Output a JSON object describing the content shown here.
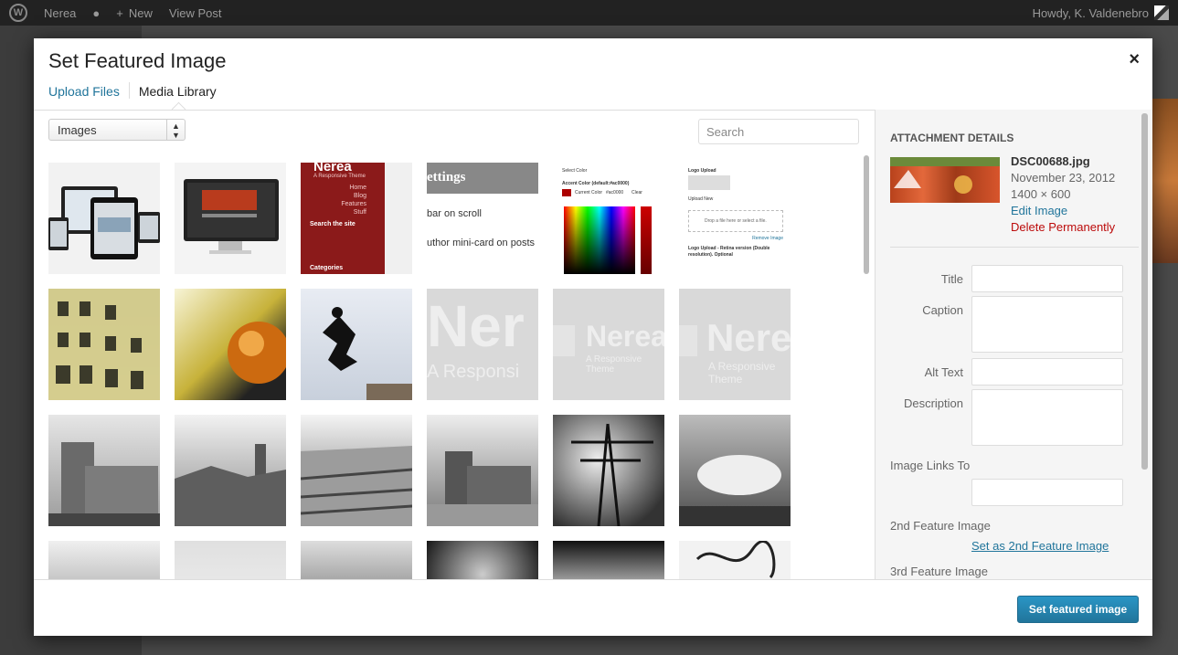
{
  "adminbar": {
    "site_name": "Nerea",
    "new_label": "New",
    "view_post": "View Post",
    "howdy": "Howdy, K. Valdenebro"
  },
  "modal": {
    "title": "Set Featured Image",
    "close": "×",
    "tabs": {
      "upload": "Upload Files",
      "library": "Media Library"
    }
  },
  "toolbar": {
    "filter_value": "Images",
    "search_placeholder": "Search"
  },
  "thumbs": {
    "t3_title": "Nerea",
    "t3_sub": "A Responsive Theme",
    "t3_menu": [
      "Home",
      "Blog",
      "Features",
      "Stuff"
    ],
    "t3_search": "Search the site",
    "t3_categories": "Categories",
    "t4_title": "ettings",
    "t4_line1": "bar on scroll",
    "t4_line2": "uthor mini-card on posts",
    "t5_select": "Select Color",
    "t5_accent": "Accent Color (default:#ac0000)",
    "t5_current": "Current Color",
    "t5_hex": "#ac0000",
    "t5_clear": "Clear",
    "t6_logo": "Logo Upload",
    "t6_upload": "Upload New",
    "t6_drop": "Drop a file here or select a file.",
    "t6_remove": "Remove Image",
    "t6_retina": "Logo Upload - Retina version (Double resolution). Optional",
    "nerea_big": "Nerea",
    "nerea_sub": "A Responsive Theme",
    "nerea_short": "Ner",
    "nerea_short_sub": "A Responsi"
  },
  "details": {
    "heading": "Attachment Details",
    "filename": "DSC00688.jpg",
    "date": "November 23, 2012",
    "dimensions": "1400 × 600",
    "edit": "Edit Image",
    "delete": "Delete Permanently",
    "title_label": "Title",
    "caption_label": "Caption",
    "alt_label": "Alt Text",
    "description_label": "Description",
    "links_label": "Image Links To",
    "feature2_label": "2nd Feature Image",
    "feature2_link": "Set as 2nd Feature Image",
    "feature3_label": "3rd Feature Image"
  },
  "footer": {
    "button": "Set featured image"
  }
}
